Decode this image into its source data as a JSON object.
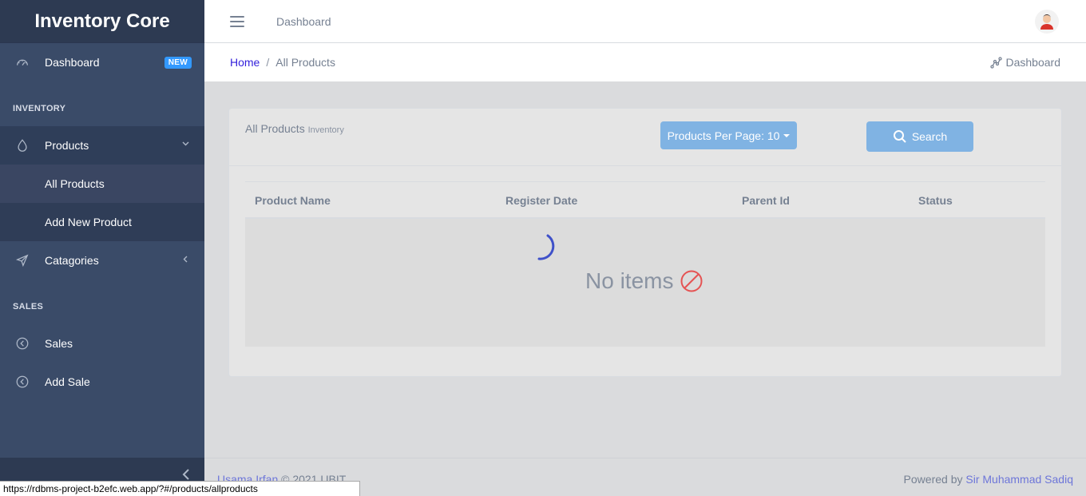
{
  "sidebar": {
    "brand": "Inventory Core",
    "dashboard": {
      "label": "Dashboard",
      "badge": "NEW"
    },
    "sections": {
      "inventory": "INVENTORY",
      "sales": "SALES"
    },
    "products": {
      "label": "Products",
      "children": [
        "All Products",
        "Add New Product"
      ]
    },
    "categories": {
      "label": "Catagories"
    },
    "sales_items": [
      "Sales",
      "Add Sale"
    ]
  },
  "header": {
    "link": "Dashboard"
  },
  "breadcrumb": {
    "home": "Home",
    "separator": "/",
    "current": "All Products",
    "right_link": "Dashboard"
  },
  "card": {
    "title": "All Products",
    "subtitle": "Inventory",
    "per_page_label": "Products Per Page: 10",
    "search_label": "Search"
  },
  "table": {
    "columns": [
      "Product Name",
      "Register Date",
      "Parent Id",
      "Status"
    ],
    "empty_text": "No items"
  },
  "footer": {
    "author": "Usama Irfan",
    "copyright": "© 2021 UBIT",
    "powered_prefix": "Powered by",
    "powered_name": "Sir Muhammad Sadiq"
  },
  "status_url": "https://rdbms-project-b2efc.web.app/?#/products/allproducts",
  "colors": {
    "sidebar": "#3a4b68",
    "accent": "#321fdb",
    "button": "#80b3e3",
    "badge": "#3399ff"
  }
}
